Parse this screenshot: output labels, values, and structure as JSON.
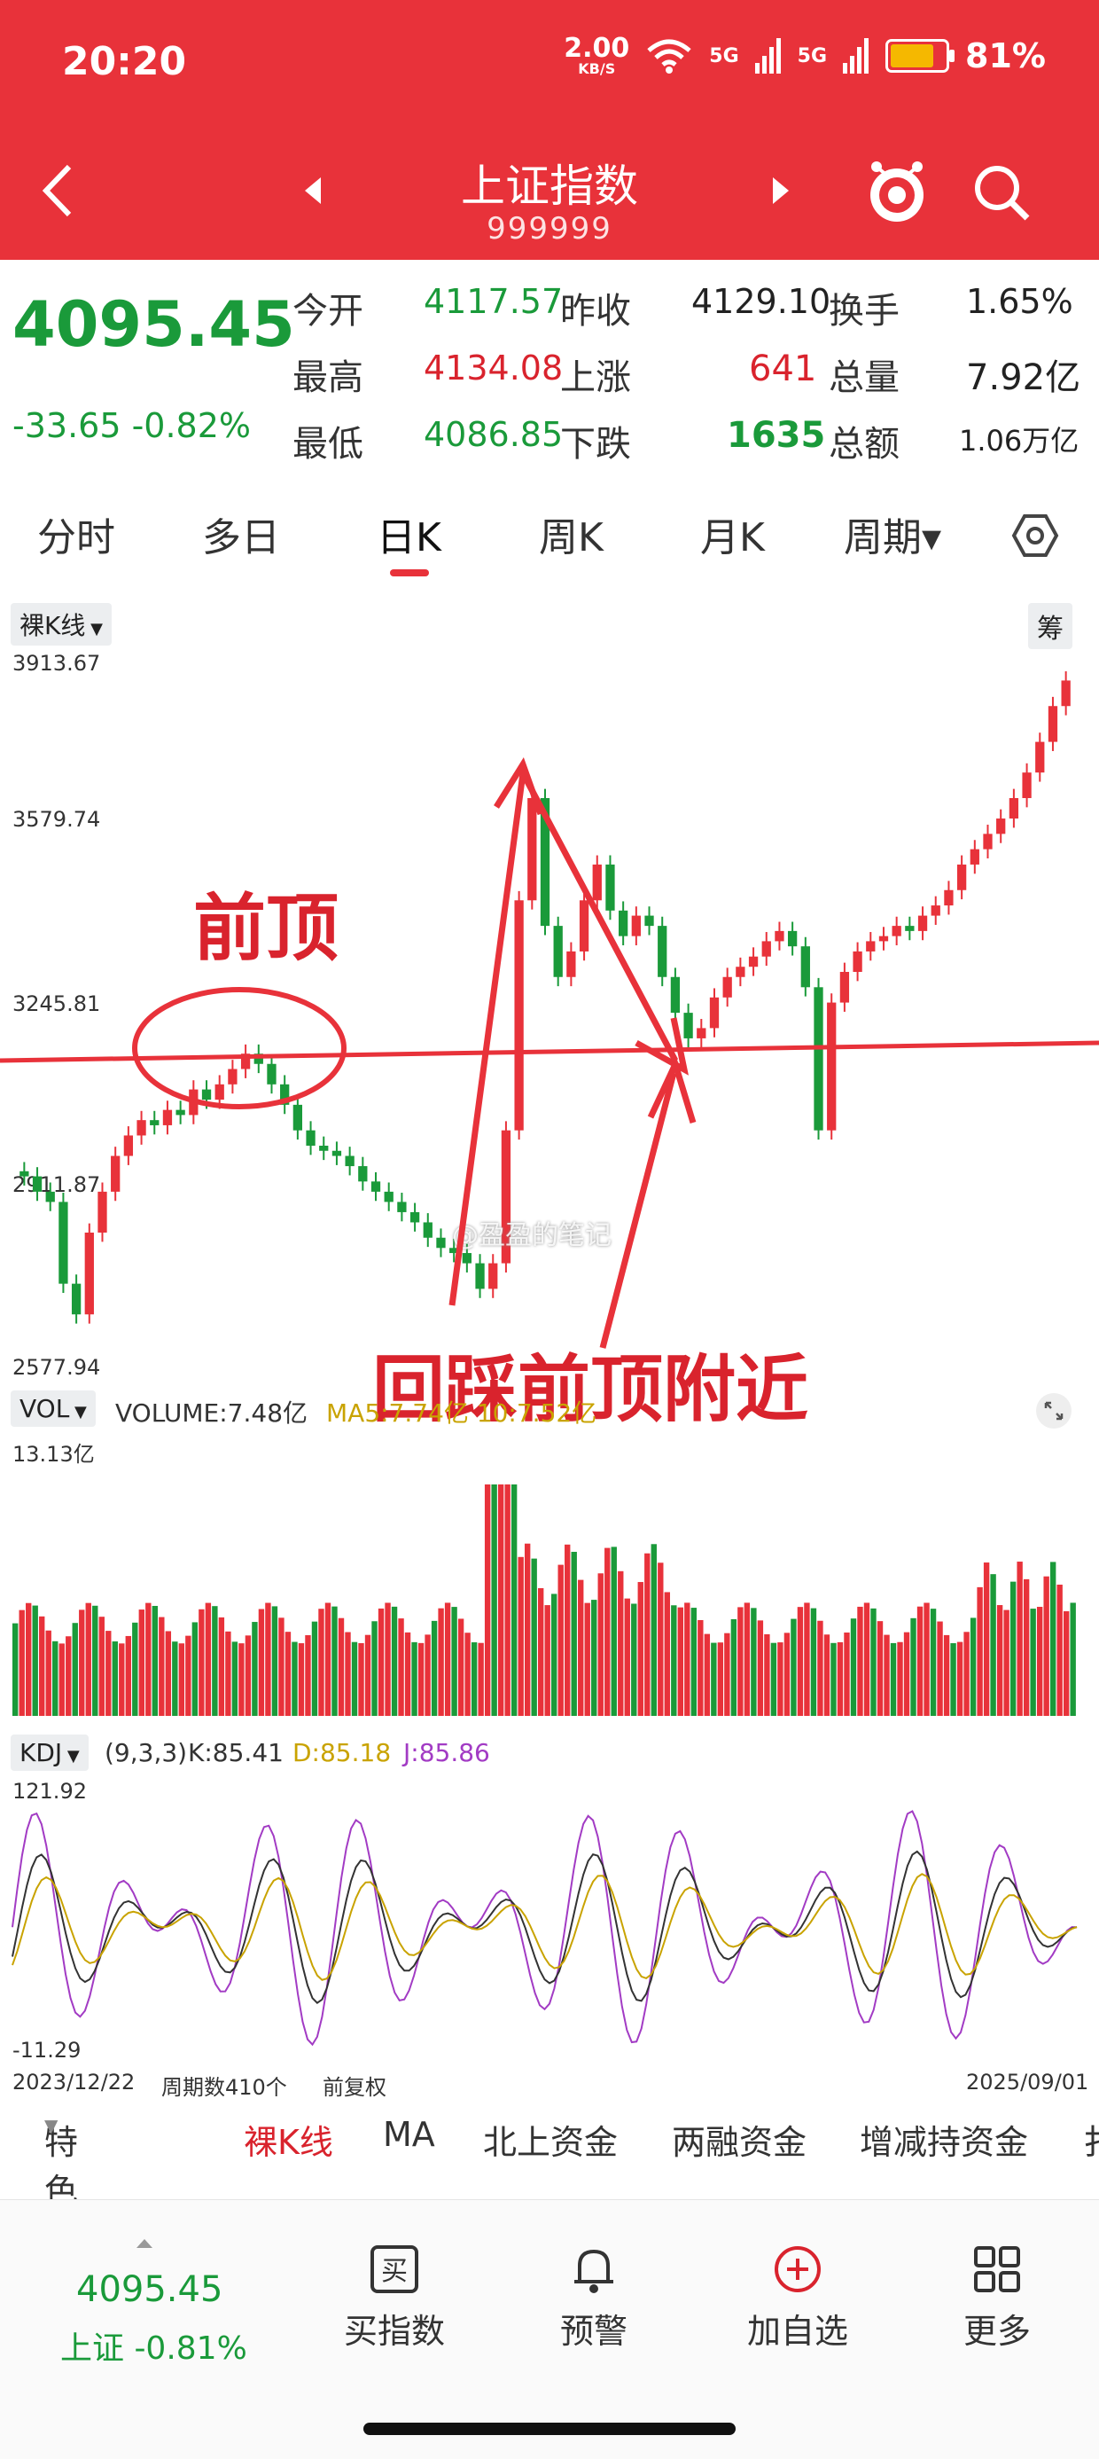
{
  "status_bar": {
    "time": "20:20",
    "net_speed": "2.00",
    "net_unit": "KB/S",
    "sig1": "5G",
    "sig2": "5G",
    "battery": "81%"
  },
  "header": {
    "title": "上证指数",
    "code": "999999"
  },
  "quote": {
    "price": "4095.45",
    "change": "-33.65 -0.82%",
    "open_label": "今开",
    "open": "4117.57",
    "prev_label": "昨收",
    "prev": "4129.10",
    "turnover_label": "换手",
    "turnover": "1.65%",
    "high_label": "最高",
    "high": "4134.08",
    "up_label": "上涨",
    "up": "641",
    "vol_label": "总量",
    "vol": "7.92亿",
    "low_label": "最低",
    "low": "4086.85",
    "down_label": "下跌",
    "down": "1635",
    "amount_label": "总额",
    "amount": "1.06万亿"
  },
  "tabs": [
    "分时",
    "多日",
    "日K",
    "周K",
    "月K",
    "周期▾"
  ],
  "kline": {
    "mode": "裸K线",
    "chip_button": "筹",
    "y_labels": [
      "3913.67",
      "3579.74",
      "3245.81",
      "2911.87",
      "2577.94"
    ]
  },
  "volume": {
    "label": "VOL",
    "text": "VOLUME:7.48亿",
    "ma": "MA5:7.74亿 10:7.52亿",
    "max": "13.13亿"
  },
  "kdj": {
    "label": "KDJ",
    "params": "(9,3,3)",
    "k": "K:85.41",
    "d": "D:85.18",
    "j": "J:85.86",
    "max": "121.92",
    "min": "-11.29"
  },
  "footer_axis": {
    "start": "2023/12/22",
    "periods": "周期数410个",
    "adjust": "前复权",
    "end": "2025/09/01"
  },
  "annotations": {
    "prev_top": "前顶",
    "retest": "回踩前顶附近",
    "watermark": "@盈盈的笔记"
  },
  "bottom_tabs": [
    "特色",
    "裸K线",
    "MA",
    "北上资金",
    "两融资金",
    "增减持资金",
    "扌"
  ],
  "bottom_bar": {
    "price": "4095.45",
    "index": "上证 -0.81%",
    "buy": "买指数",
    "alert": "预警",
    "add": "加自选",
    "more": "更多"
  },
  "colors": {
    "header": "#e8323a",
    "up": "#e8323a",
    "down": "#1a9a3a"
  },
  "chart_data": {
    "type": "candlestick",
    "y_range": [
      2577.94,
      3913.67
    ],
    "x_range": [
      "2023/12/22",
      "2025/09/01"
    ],
    "close_approx": [
      2910,
      2880,
      2860,
      2700,
      2640,
      2800,
      2880,
      2950,
      2990,
      3020,
      3010,
      3040,
      3030,
      3080,
      3060,
      3090,
      3120,
      3150,
      3130,
      3090,
      3050,
      3000,
      2970,
      2960,
      2950,
      2930,
      2900,
      2880,
      2860,
      2840,
      2820,
      2790,
      2770,
      2760,
      2740,
      2690,
      2740,
      3000,
      3450,
      3650,
      3400,
      3300,
      3350,
      3450,
      3520,
      3430,
      3380,
      3420,
      3400,
      3300,
      3230,
      3180,
      3200,
      3260,
      3300,
      3320,
      3340,
      3370,
      3390,
      3360,
      3280,
      3000,
      3250,
      3310,
      3350,
      3370,
      3380,
      3400,
      3390,
      3420,
      3440,
      3470,
      3520,
      3550,
      3580,
      3610,
      3650,
      3700,
      3760,
      3830,
      3880
    ],
    "kdj_range": [
      -11.29,
      121.92
    ]
  }
}
